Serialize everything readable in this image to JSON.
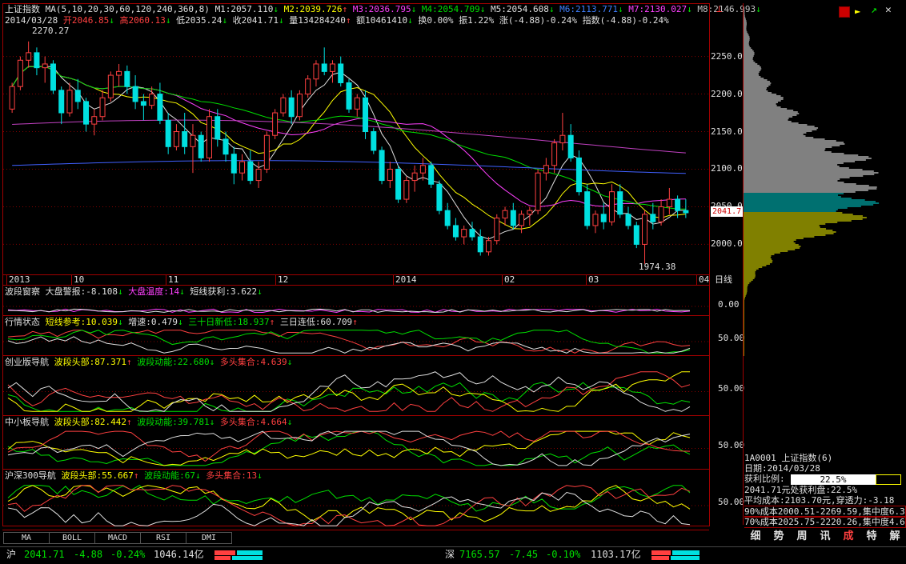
{
  "main_header": {
    "index_name": "上证指数",
    "ma_label": "MA(5,10,20,30,60,120,240,360,8)",
    "ma_values": [
      {
        "label": "M1:2057.110",
        "arrow": "↓",
        "color": "#e0e0e0"
      },
      {
        "label": "M2:2039.726",
        "arrow": "↑",
        "color": "#ffff00"
      },
      {
        "label": "M3:2036.795",
        "arrow": "↓",
        "color": "#ff40ff"
      },
      {
        "label": "M4:2054.709",
        "arrow": "↓",
        "color": "#00e000"
      },
      {
        "label": "M5:2054.608",
        "arrow": "↓",
        "color": "#e0e0e0"
      },
      {
        "label": "M6:2113.771",
        "arrow": "↓",
        "color": "#4080ff"
      },
      {
        "label": "M7:2130.027",
        "arrow": "↓",
        "color": "#ff40ff"
      },
      {
        "label": "M8:2146.993",
        "arrow": "↓",
        "color": "#c0c0c0"
      }
    ],
    "date": "2014/03/28",
    "quote": [
      {
        "t": "开2046.85",
        "a": "↓",
        "c": "#ff4040"
      },
      {
        "t": "高2060.13",
        "a": "↓",
        "c": "#ff4040"
      },
      {
        "t": "低2035.24",
        "a": "↓",
        "c": "#e0e0e0"
      },
      {
        "t": "收2041.71",
        "a": "↓",
        "c": "#e0e0e0"
      },
      {
        "t": "量134284240",
        "a": "↑",
        "c": "#e0e0e0"
      },
      {
        "t": "额10461410",
        "a": "↓",
        "c": "#e0e0e0"
      },
      {
        "t": "换0.00%",
        "a": "",
        "c": "#e0e0e0"
      },
      {
        "t": "振1.22%",
        "a": "",
        "c": "#e0e0e0"
      },
      {
        "t": "涨(-4.88)-0.24%",
        "a": "",
        "c": "#e0e0e0"
      },
      {
        "t": "指数(-4.88)-0.24%",
        "a": "",
        "c": "#e0e0e0"
      }
    ],
    "high_marker": "2270.27",
    "low_marker": "1974.38",
    "current_price_tag": "2041.7",
    "period": "日线"
  },
  "chart_data": {
    "type": "candlestick",
    "ylim": [
      1960,
      2290
    ],
    "y_ticks": [
      "2250.0",
      "2200.0",
      "2150.0",
      "2100.0",
      "2050.0",
      "2000.0"
    ],
    "x_ticks": [
      "2013",
      "10",
      "11",
      "12",
      "2014",
      "02",
      "03",
      "04"
    ],
    "candles": [
      [
        2180,
        2215,
        2175,
        2210
      ],
      [
        2210,
        2250,
        2205,
        2245
      ],
      [
        2245,
        2270,
        2235,
        2255
      ],
      [
        2255,
        2262,
        2225,
        2235
      ],
      [
        2235,
        2250,
        2215,
        2240
      ],
      [
        2240,
        2245,
        2200,
        2205
      ],
      [
        2205,
        2210,
        2160,
        2175
      ],
      [
        2175,
        2215,
        2170,
        2205
      ],
      [
        2205,
        2220,
        2180,
        2190
      ],
      [
        2190,
        2195,
        2150,
        2160
      ],
      [
        2160,
        2180,
        2145,
        2170
      ],
      [
        2170,
        2205,
        2165,
        2195
      ],
      [
        2195,
        2230,
        2190,
        2225
      ],
      [
        2225,
        2240,
        2210,
        2230
      ],
      [
        2230,
        2238,
        2200,
        2210
      ],
      [
        2210,
        2225,
        2180,
        2190
      ],
      [
        2190,
        2200,
        2165,
        2185
      ],
      [
        2185,
        2210,
        2180,
        2200
      ],
      [
        2200,
        2215,
        2160,
        2165
      ],
      [
        2165,
        2175,
        2120,
        2130
      ],
      [
        2130,
        2160,
        2125,
        2150
      ],
      [
        2150,
        2175,
        2120,
        2130
      ],
      [
        2130,
        2160,
        2095,
        2145
      ],
      [
        2145,
        2150,
        2110,
        2115
      ],
      [
        2115,
        2180,
        2110,
        2170
      ],
      [
        2170,
        2180,
        2130,
        2140
      ],
      [
        2140,
        2150,
        2110,
        2120
      ],
      [
        2120,
        2130,
        2080,
        2095
      ],
      [
        2095,
        2120,
        2085,
        2110
      ],
      [
        2110,
        2125,
        2080,
        2085
      ],
      [
        2085,
        2110,
        2075,
        2100
      ],
      [
        2100,
        2150,
        2095,
        2145
      ],
      [
        2145,
        2180,
        2140,
        2175
      ],
      [
        2175,
        2200,
        2170,
        2195
      ],
      [
        2195,
        2205,
        2160,
        2170
      ],
      [
        2170,
        2205,
        2165,
        2200
      ],
      [
        2200,
        2225,
        2195,
        2220
      ],
      [
        2220,
        2245,
        2210,
        2240
      ],
      [
        2240,
        2262,
        2225,
        2230
      ],
      [
        2230,
        2245,
        2215,
        2240
      ],
      [
        2240,
        2250,
        2210,
        2215
      ],
      [
        2215,
        2220,
        2175,
        2180
      ],
      [
        2180,
        2200,
        2170,
        2195
      ],
      [
        2195,
        2205,
        2140,
        2150
      ],
      [
        2150,
        2155,
        2120,
        2125
      ],
      [
        2125,
        2130,
        2080,
        2085
      ],
      [
        2085,
        2110,
        2075,
        2100
      ],
      [
        2100,
        2105,
        2055,
        2060
      ],
      [
        2060,
        2090,
        2055,
        2085
      ],
      [
        2085,
        2105,
        2070,
        2095
      ],
      [
        2095,
        2115,
        2085,
        2105
      ],
      [
        2105,
        2110,
        2075,
        2080
      ],
      [
        2080,
        2085,
        2040,
        2045
      ],
      [
        2045,
        2055,
        2020,
        2025
      ],
      [
        2025,
        2035,
        2005,
        2010
      ],
      [
        2010,
        2025,
        2000,
        2020
      ],
      [
        2020,
        2030,
        2005,
        2010
      ],
      [
        2010,
        2020,
        1985,
        1990
      ],
      [
        1990,
        2010,
        1985,
        2005
      ],
      [
        2005,
        2040,
        2000,
        2035
      ],
      [
        2035,
        2050,
        2025,
        2045
      ],
      [
        2045,
        2055,
        2020,
        2025
      ],
      [
        2025,
        2045,
        2015,
        2040
      ],
      [
        2040,
        2050,
        2025,
        2045
      ],
      [
        2045,
        2100,
        2040,
        2095
      ],
      [
        2095,
        2115,
        2085,
        2105
      ],
      [
        2105,
        2140,
        2095,
        2135
      ],
      [
        2135,
        2175,
        2125,
        2145
      ],
      [
        2145,
        2160,
        2110,
        2115
      ],
      [
        2115,
        2125,
        2065,
        2070
      ],
      [
        2070,
        2080,
        2020,
        2025
      ],
      [
        2025,
        2045,
        2015,
        2040
      ],
      [
        2040,
        2055,
        2020,
        2030
      ],
      [
        2030,
        2080,
        2025,
        2070
      ],
      [
        2070,
        2080,
        2035,
        2040
      ],
      [
        2040,
        2050,
        2020,
        2025
      ],
      [
        2025,
        2030,
        1995,
        2000
      ],
      [
        2000,
        2045,
        1974,
        2040
      ],
      [
        2040,
        2055,
        2020,
        2030
      ],
      [
        2030,
        2060,
        2025,
        2050
      ],
      [
        2050,
        2075,
        2040,
        2060
      ],
      [
        2060,
        2065,
        2035,
        2045
      ],
      [
        2045,
        2060,
        2035,
        2042
      ]
    ]
  },
  "indicators": [
    {
      "name": "波段窗察",
      "items": [
        {
          "t": "大盘警报:-8.108",
          "a": "↓",
          "c": "#e0e0e0"
        },
        {
          "t": "大盘温度:14",
          "a": "↓",
          "c": "#ff40ff"
        },
        {
          "t": "短线获利:3.622",
          "a": "↓",
          "c": "#e0e0e0"
        }
      ],
      "axis": "0.00"
    },
    {
      "name": "行情状态",
      "items": [
        {
          "t": "短线参考:10.039",
          "a": "↓",
          "c": "#ffff00"
        },
        {
          "t": "增速:0.479",
          "a": "↓",
          "c": "#e0e0e0"
        },
        {
          "t": "三十日新低:18.937",
          "a": "↑",
          "c": "#00e000"
        },
        {
          "t": "三日连低:60.709",
          "a": "↑",
          "c": "#e0e0e0"
        }
      ],
      "axis": "50.00"
    },
    {
      "name": "创业版导航",
      "items": [
        {
          "t": "波段头部:87.371",
          "a": "↑",
          "c": "#ffff00"
        },
        {
          "t": "波段动能:22.680",
          "a": "↓",
          "c": "#00e000"
        },
        {
          "t": "多头集合:4.639",
          "a": "↓",
          "c": "#ff4040"
        }
      ],
      "axis": "50.00"
    },
    {
      "name": "中小板导航",
      "items": [
        {
          "t": "波段头部:82.442",
          "a": "↑",
          "c": "#ffff00"
        },
        {
          "t": "波段动能:39.781",
          "a": "↓",
          "c": "#00e000"
        },
        {
          "t": "多头集合:4.664",
          "a": "↓",
          "c": "#ff4040"
        }
      ],
      "axis": "50.00"
    },
    {
      "name": "沪深300导航",
      "items": [
        {
          "t": "波段头部:55.667",
          "a": "↑",
          "c": "#ffff00"
        },
        {
          "t": "波段动能:67",
          "a": "↓",
          "c": "#00e000"
        },
        {
          "t": "多头集合:13",
          "a": "↓",
          "c": "#ff4040"
        }
      ],
      "axis": "50.00"
    }
  ],
  "tabs": [
    "MA",
    "BOLL",
    "MACD",
    "RSI",
    "DMI"
  ],
  "right_panel": {
    "code_line": "1A0001  上证指数(6)",
    "date_line": "日期:2014/03/28",
    "profit_label": "获利比例:",
    "profit_pct": "22.5%",
    "profit_fraction": 0.225,
    "lines": [
      "2041.71元处获利盘:22.5%",
      "平均成本:2103.70元,穿透力:-3.18",
      "90%成本2000.51-2269.59,集中度6.3",
      "70%成本2025.75-2220.26,集中度4.6"
    ],
    "buttons": [
      "细",
      "势",
      "周",
      "讯",
      "成",
      "特",
      "解"
    ]
  },
  "status_bar": {
    "sh_label": "沪",
    "sh_price": "2041.71",
    "sh_change": "-4.88",
    "sh_pct": "-0.24%",
    "sh_amount": "1046.14亿",
    "sz_label": "深",
    "sz_price": "7165.57",
    "sz_change": "-7.45",
    "sz_pct": "-0.10%",
    "sz_amount": "1103.17亿"
  }
}
